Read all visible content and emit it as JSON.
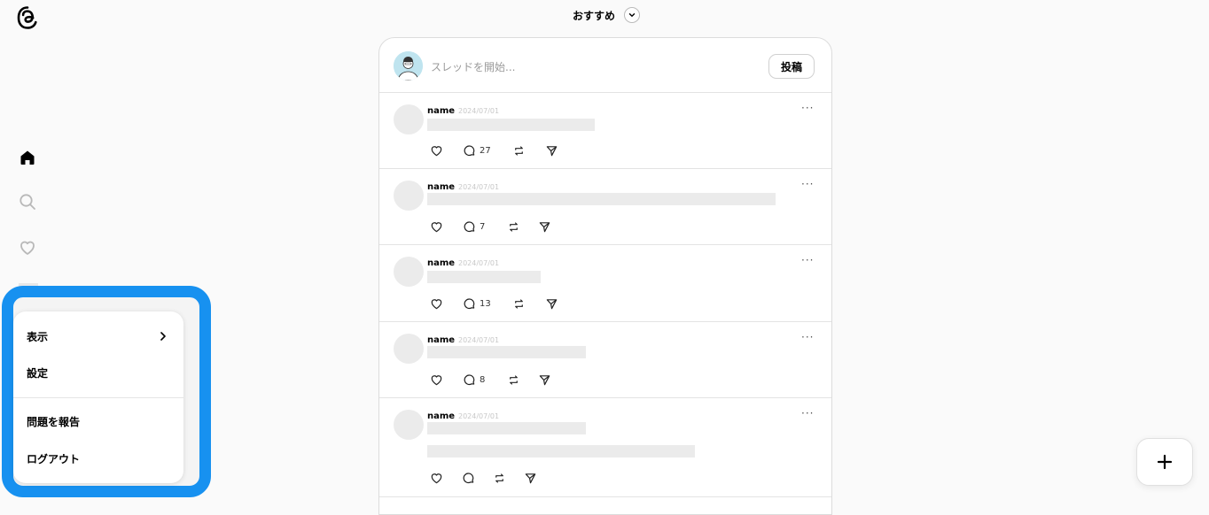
{
  "header": {
    "feed_label": "おすすめ"
  },
  "composer": {
    "placeholder": "スレッドを開始...",
    "post_button": "投稿"
  },
  "menu": {
    "items": [
      {
        "label": "表示",
        "has_submenu": true
      },
      {
        "label": "設定",
        "has_submenu": false
      },
      {
        "label": "問題を報告",
        "has_submenu": false
      },
      {
        "label": "ログアウト",
        "has_submenu": false
      }
    ]
  },
  "posts": [
    {
      "username": "name",
      "date": "2024/07/01",
      "reply_count": "27",
      "more": "···"
    },
    {
      "username": "name",
      "date": "2024/07/01",
      "reply_count": "7",
      "more": "···"
    },
    {
      "username": "name",
      "date": "2024/07/01",
      "reply_count": "13",
      "more": "···"
    },
    {
      "username": "name",
      "date": "2024/07/01",
      "reply_count": "8",
      "more": "···"
    },
    {
      "username": "name",
      "date": "2024/07/01",
      "reply_count": "",
      "more": "···"
    }
  ],
  "icons": {
    "logo": "threads-logo-icon",
    "nav": [
      "home-icon",
      "search-icon",
      "heart-icon"
    ],
    "post_actions": [
      "heart-icon",
      "comment-icon",
      "repost-icon",
      "share-icon"
    ],
    "fab": "plus-icon"
  },
  "colors": {
    "highlight": "#1791f0",
    "background": "#fafafa",
    "placeholder_bar": "#ebebeb"
  }
}
